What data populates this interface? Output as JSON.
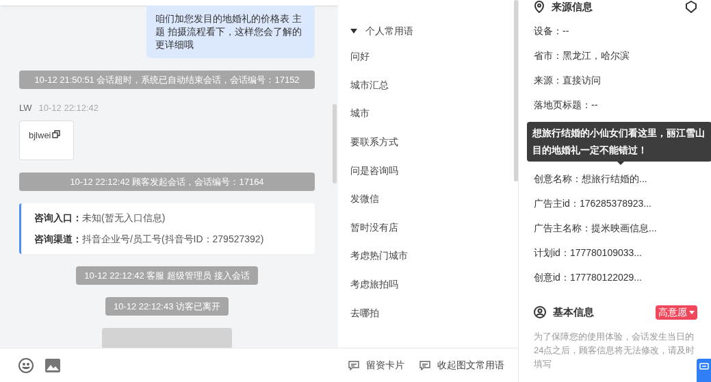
{
  "chat": {
    "messages": [
      {
        "kind": "agent_bubble",
        "text": "咱们加您发目的地婚礼的价格表 主题 拍摄流程看下，这样您会了解的更详细哦"
      },
      {
        "kind": "system",
        "text": "10-12 21:50:51 会话超时，系统已自动结束会话，会话编号：17152"
      },
      {
        "kind": "visitor",
        "sender": "LW",
        "time": "10-12 22:12:42",
        "text": "bjlwei"
      },
      {
        "kind": "system",
        "text": "10-12 22:12:42 顾客发起会话，会话编号：17164"
      },
      {
        "kind": "info_card",
        "lines": [
          {
            "label": "咨询入口：",
            "value": "未知(暂无入口信息)"
          },
          {
            "label": "咨询渠道：",
            "value": "抖音企业号/员工号(抖音号ID：279527392)"
          }
        ]
      },
      {
        "kind": "system",
        "text": "10-12 22:12:42 客服 超级管理员 接入会话"
      },
      {
        "kind": "system",
        "text": "10-12 22:12:43 访客已离开"
      }
    ]
  },
  "phrases": {
    "group": {
      "title": "个人常用语",
      "expanded": true
    },
    "items": [
      "问好",
      "城市汇总",
      "城市",
      "要联系方式",
      "问是咨询吗",
      "发微信",
      "暂时没有店",
      "考虑热门城市",
      "考虑旅拍吗",
      "去哪拍"
    ],
    "footer": [
      "留资卡片",
      "收起图文常用语"
    ]
  },
  "source_info": {
    "title": "来源信息",
    "rows": [
      {
        "text": "设备：--"
      },
      {
        "text": "省市：黑龙江，哈尔滨"
      },
      {
        "text": "来源：直接访问"
      },
      {
        "text": "落地页标题：--"
      },
      {
        "text": null
      },
      {
        "text": null
      },
      {
        "text": "创意名称：想旅行结婚的..."
      },
      {
        "text": "广告主id：176285378923..."
      },
      {
        "text": "广告主名称：提米映画信息..."
      },
      {
        "text": "计划id：177780109033..."
      },
      {
        "text": "创意id：177780122029..."
      }
    ],
    "tooltip": "想旅行结婚的小仙女们看这里，丽江雪山目的地婚礼一定不能错过！"
  },
  "basic_info": {
    "title": "基本信息",
    "tag": "高意愿",
    "note": "为了保障您的使用体验，会话发生当日的24点之后，顾客信息将无法修改，请及时填写"
  }
}
